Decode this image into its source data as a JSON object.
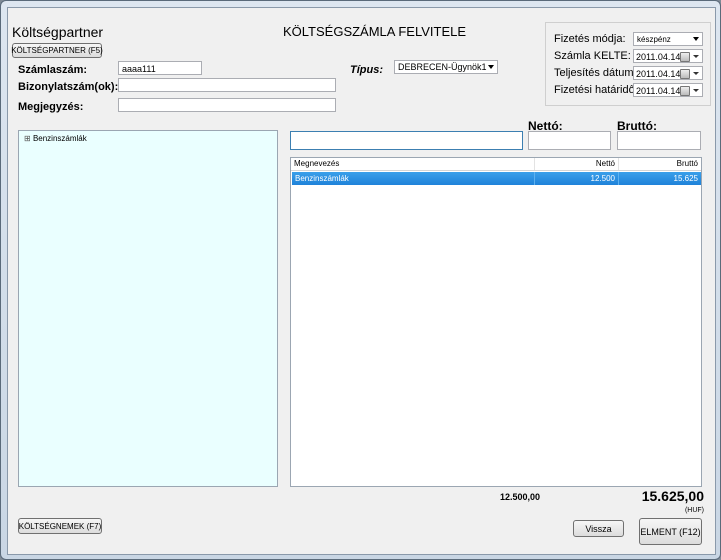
{
  "form": {
    "partner_heading": "Költségpartner",
    "title": "KÖLTSÉGSZÁMLA FELVITELE",
    "partner_button": "KÖLTSÉGPARTNER (F5)",
    "invoice_number_label": "Számlaszám:",
    "invoice_number_value": "aaaa111",
    "document_numbers_label": "Bizonylatszám(ok):",
    "document_numbers_value": "",
    "note_label": "Megjegyzés:",
    "note_value": "",
    "type_label": "Típus:",
    "type_value": "DEBRECEN-Ügynök1"
  },
  "payment": {
    "method_label": "Fizetés módja:",
    "method_value": "készpénz",
    "issue_date_label": "Számla KELTE:",
    "issue_date_value": "2011.04.14.",
    "fulfilment_date_label": "Teljesítés dátuma:",
    "fulfilment_date_value": "2011.04.14.",
    "due_date_label": "Fizetési határidő:",
    "due_date_value": "2011.04.14."
  },
  "tree": {
    "expander": "⊞",
    "root_label": "Benzinszámlák"
  },
  "entry": {
    "net_label": "Nettó:",
    "gross_label": "Bruttó:",
    "name_value": "",
    "net_value": "",
    "gross_value": ""
  },
  "grid": {
    "columns": [
      "Megnevezés",
      "Nettó",
      "Bruttó"
    ],
    "rows": [
      {
        "name": "Benzinszámlák",
        "net": "12.500",
        "gross": "15.625"
      }
    ]
  },
  "totals": {
    "net_total": "12.500,00",
    "gross_total": "15.625,00",
    "currency": "(HUF)"
  },
  "buttons": {
    "cost_types": "KÖLTSÉGNEMEK (F7)",
    "back": "Vissza",
    "save": "ELMENT (F12)"
  }
}
